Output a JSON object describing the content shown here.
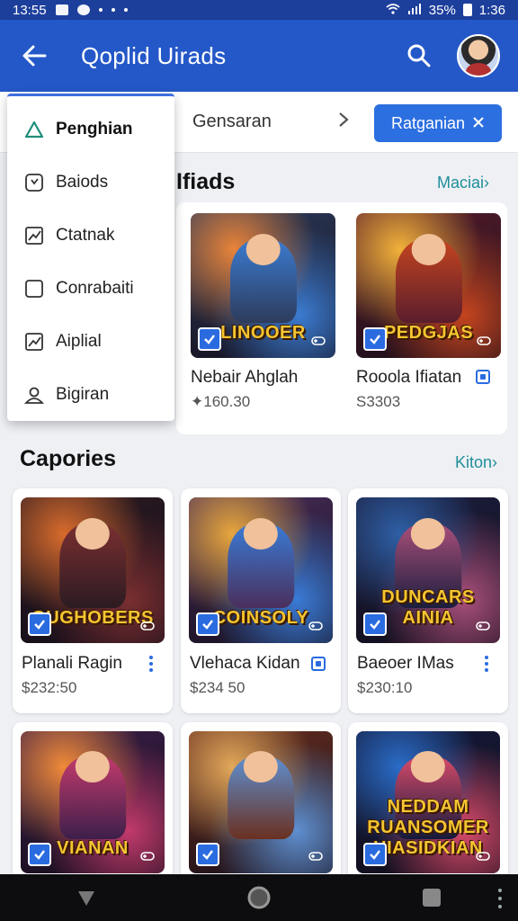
{
  "status": {
    "time": "13:55",
    "battery": "35%",
    "clock_right": "1:36"
  },
  "app_bar": {
    "title": "Qoplid Uirads"
  },
  "tabs": {
    "text": "Gensaran",
    "button_label": "Ratganian"
  },
  "menu": {
    "items": [
      {
        "label": "Penghian",
        "icon": "home-icon"
      },
      {
        "label": "Baiods",
        "icon": "clock-icon"
      },
      {
        "label": "Ctatnak",
        "icon": "chart-icon"
      },
      {
        "label": "Conrabaiti",
        "icon": "square-icon"
      },
      {
        "label": "Aiplial",
        "icon": "chart-icon"
      },
      {
        "label": "Bigiran",
        "icon": "user-icon"
      }
    ]
  },
  "featured": {
    "heading": "Ifiads",
    "link": "Maciai›",
    "items": [
      {
        "name": "Nebair Ahglah",
        "price": "✦160.30",
        "art_title": "LINOOER",
        "colors": [
          "#e9843a",
          "#3b7bd0",
          "#2d3c5c"
        ]
      },
      {
        "name": "Rooola Ifiatan",
        "price": "S3303",
        "art_title": "PEDGJAS",
        "colors": [
          "#f2b13a",
          "#c4441f",
          "#5a1d2c"
        ]
      }
    ]
  },
  "categories": {
    "heading": "Capories",
    "link": "Kiton›",
    "items": [
      {
        "name": "Planali Ragin",
        "price": "$232:50",
        "art_title": "GUGHOBERS",
        "colors": [
          "#d86b2c",
          "#7a2f30",
          "#2c1b22"
        ]
      },
      {
        "name": "Vlehaca Kidan",
        "price": "$234 50",
        "art_title": "COINSOLY",
        "colors": [
          "#e7a63d",
          "#3a7bd6",
          "#4a2f5c"
        ]
      },
      {
        "name": "Baeoer IMas",
        "price": "$230:10",
        "art_title": "DUNCARS AINIA",
        "colors": [
          "#2e5fa5",
          "#a94f7a",
          "#1b1e3e"
        ]
      },
      {
        "name": "",
        "price": "",
        "art_title": "VIANAN",
        "colors": [
          "#f08a3a",
          "#c23a6c",
          "#3d1f4a"
        ]
      },
      {
        "name": "",
        "price": "",
        "art_title": "",
        "colors": [
          "#e2a85a",
          "#5e8fd0",
          "#6a3020"
        ]
      },
      {
        "name": "",
        "price": "",
        "art_title": "NEDDAM RUANSOMER HIASIDKIAN",
        "colors": [
          "#2a6cc8",
          "#d64a6a",
          "#141a3a"
        ]
      }
    ]
  },
  "accent_color": "#2458c8"
}
